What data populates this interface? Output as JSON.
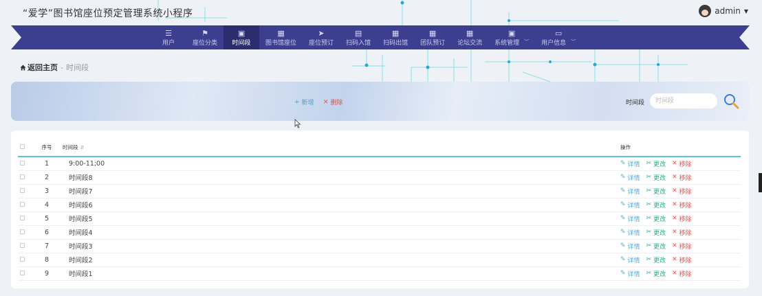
{
  "app": {
    "title": "“爱学”图书馆座位预定管理系统小程序",
    "username": "admin"
  },
  "nav": {
    "items": [
      {
        "label": "用户",
        "icon": "☰"
      },
      {
        "label": "座位分类",
        "icon": "⚑"
      },
      {
        "label": "时间段",
        "icon": "▣",
        "active": true
      },
      {
        "label": "图书馆座位",
        "icon": "▦"
      },
      {
        "label": "座位预订",
        "icon": "➤"
      },
      {
        "label": "扫码入馆",
        "icon": "▤"
      },
      {
        "label": "扫码出馆",
        "icon": "▦"
      },
      {
        "label": "团队预订",
        "icon": "▦"
      },
      {
        "label": "论坛交流",
        "icon": "▦"
      },
      {
        "label": "系统管理",
        "icon": "▣",
        "dropdown": true
      },
      {
        "label": "用户信息",
        "icon": "▭",
        "dropdown": true
      }
    ]
  },
  "breadcrumb": {
    "home": "返回主页",
    "separator": "-",
    "current": "时间段"
  },
  "toolbar": {
    "add_label": "新增",
    "delete_label": "删除",
    "search_label": "时间段",
    "search_placeholder": "时间段"
  },
  "table": {
    "headers": {
      "index": "序号",
      "time": "时间段",
      "ops": "操作"
    },
    "op_labels": {
      "view": "详情",
      "edit": "更改",
      "remove": "移除"
    },
    "rows": [
      {
        "index": "1",
        "time": "9:00-11;00"
      },
      {
        "index": "2",
        "time": "时间段8"
      },
      {
        "index": "3",
        "time": "时间段7"
      },
      {
        "index": "4",
        "time": "时间段6"
      },
      {
        "index": "5",
        "time": "时间段5"
      },
      {
        "index": "6",
        "time": "时间段4"
      },
      {
        "index": "7",
        "time": "时间段3"
      },
      {
        "index": "8",
        "time": "时间段2"
      },
      {
        "index": "9",
        "time": "时间段1"
      }
    ]
  },
  "colors": {
    "nav_bg": "#3c3f8f",
    "nav_active": "#2b2d6e",
    "accent_line": "#5cc3d4",
    "view": "#5aa8d0",
    "edit": "#2fa88a",
    "remove": "#e05050"
  }
}
